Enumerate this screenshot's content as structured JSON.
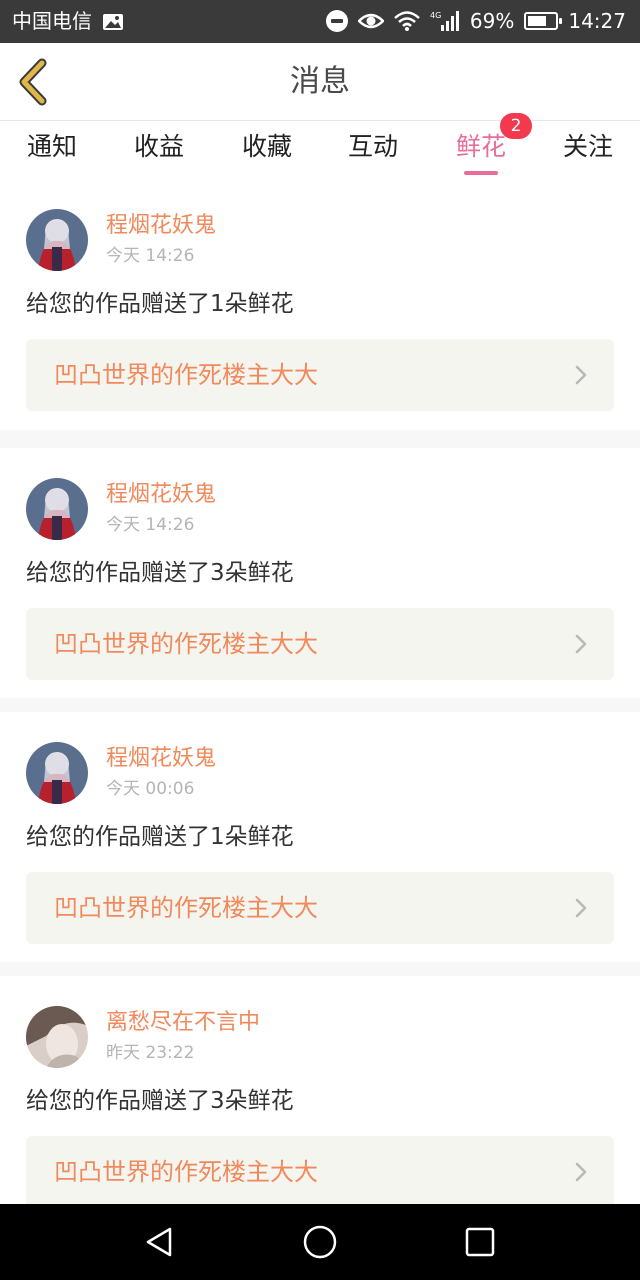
{
  "status": {
    "carrier": "中国电信",
    "battery": "69%",
    "time": "14:27",
    "network": "4G"
  },
  "header": {
    "title": "消息"
  },
  "tabs": [
    {
      "label": "通知"
    },
    {
      "label": "收益"
    },
    {
      "label": "收藏"
    },
    {
      "label": "互动"
    },
    {
      "label": "鲜花",
      "active": true,
      "badge": "2"
    },
    {
      "label": "关注"
    }
  ],
  "messages": [
    {
      "user": "程烟花妖鬼",
      "time": "今天 14:26",
      "text": "给您的作品赠送了1朵鲜花",
      "work": "凹凸世界的作死楼主大大"
    },
    {
      "user": "程烟花妖鬼",
      "time": "今天 14:26",
      "text": "给您的作品赠送了3朵鲜花",
      "work": "凹凸世界的作死楼主大大"
    },
    {
      "user": "程烟花妖鬼",
      "time": "今天 00:06",
      "text": "给您的作品赠送了1朵鲜花",
      "work": "凹凸世界的作死楼主大大"
    },
    {
      "user": "离愁尽在不言中",
      "time": "昨天 23:22",
      "text": "给您的作品赠送了3朵鲜花",
      "work": "凹凸世界的作死楼主大大"
    }
  ],
  "colors": {
    "accent": "#e86d9b",
    "username": "#f0895c",
    "badge": "#f2394d",
    "back_icon": "#e0b84a"
  }
}
